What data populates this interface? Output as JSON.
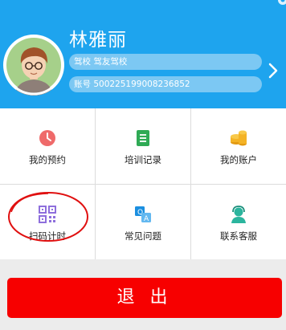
{
  "profile": {
    "name": "林雅丽",
    "school": "驾校 驾友驾校",
    "account": "账号 500225199008236852"
  },
  "grid": [
    {
      "label": "我的预约",
      "icon": "clock-icon"
    },
    {
      "label": "培训记录",
      "icon": "document-list-icon"
    },
    {
      "label": "我的账户",
      "icon": "coins-icon"
    },
    {
      "label": "扫码计时",
      "icon": "qr-code-icon"
    },
    {
      "label": "常见问题",
      "icon": "qa-icon"
    },
    {
      "label": "联系客服",
      "icon": "customer-service-icon"
    }
  ],
  "logout_label": "退 出",
  "colors": {
    "header": "#1ea4ee",
    "logout": "#f70000",
    "annotation": "#e01010"
  }
}
